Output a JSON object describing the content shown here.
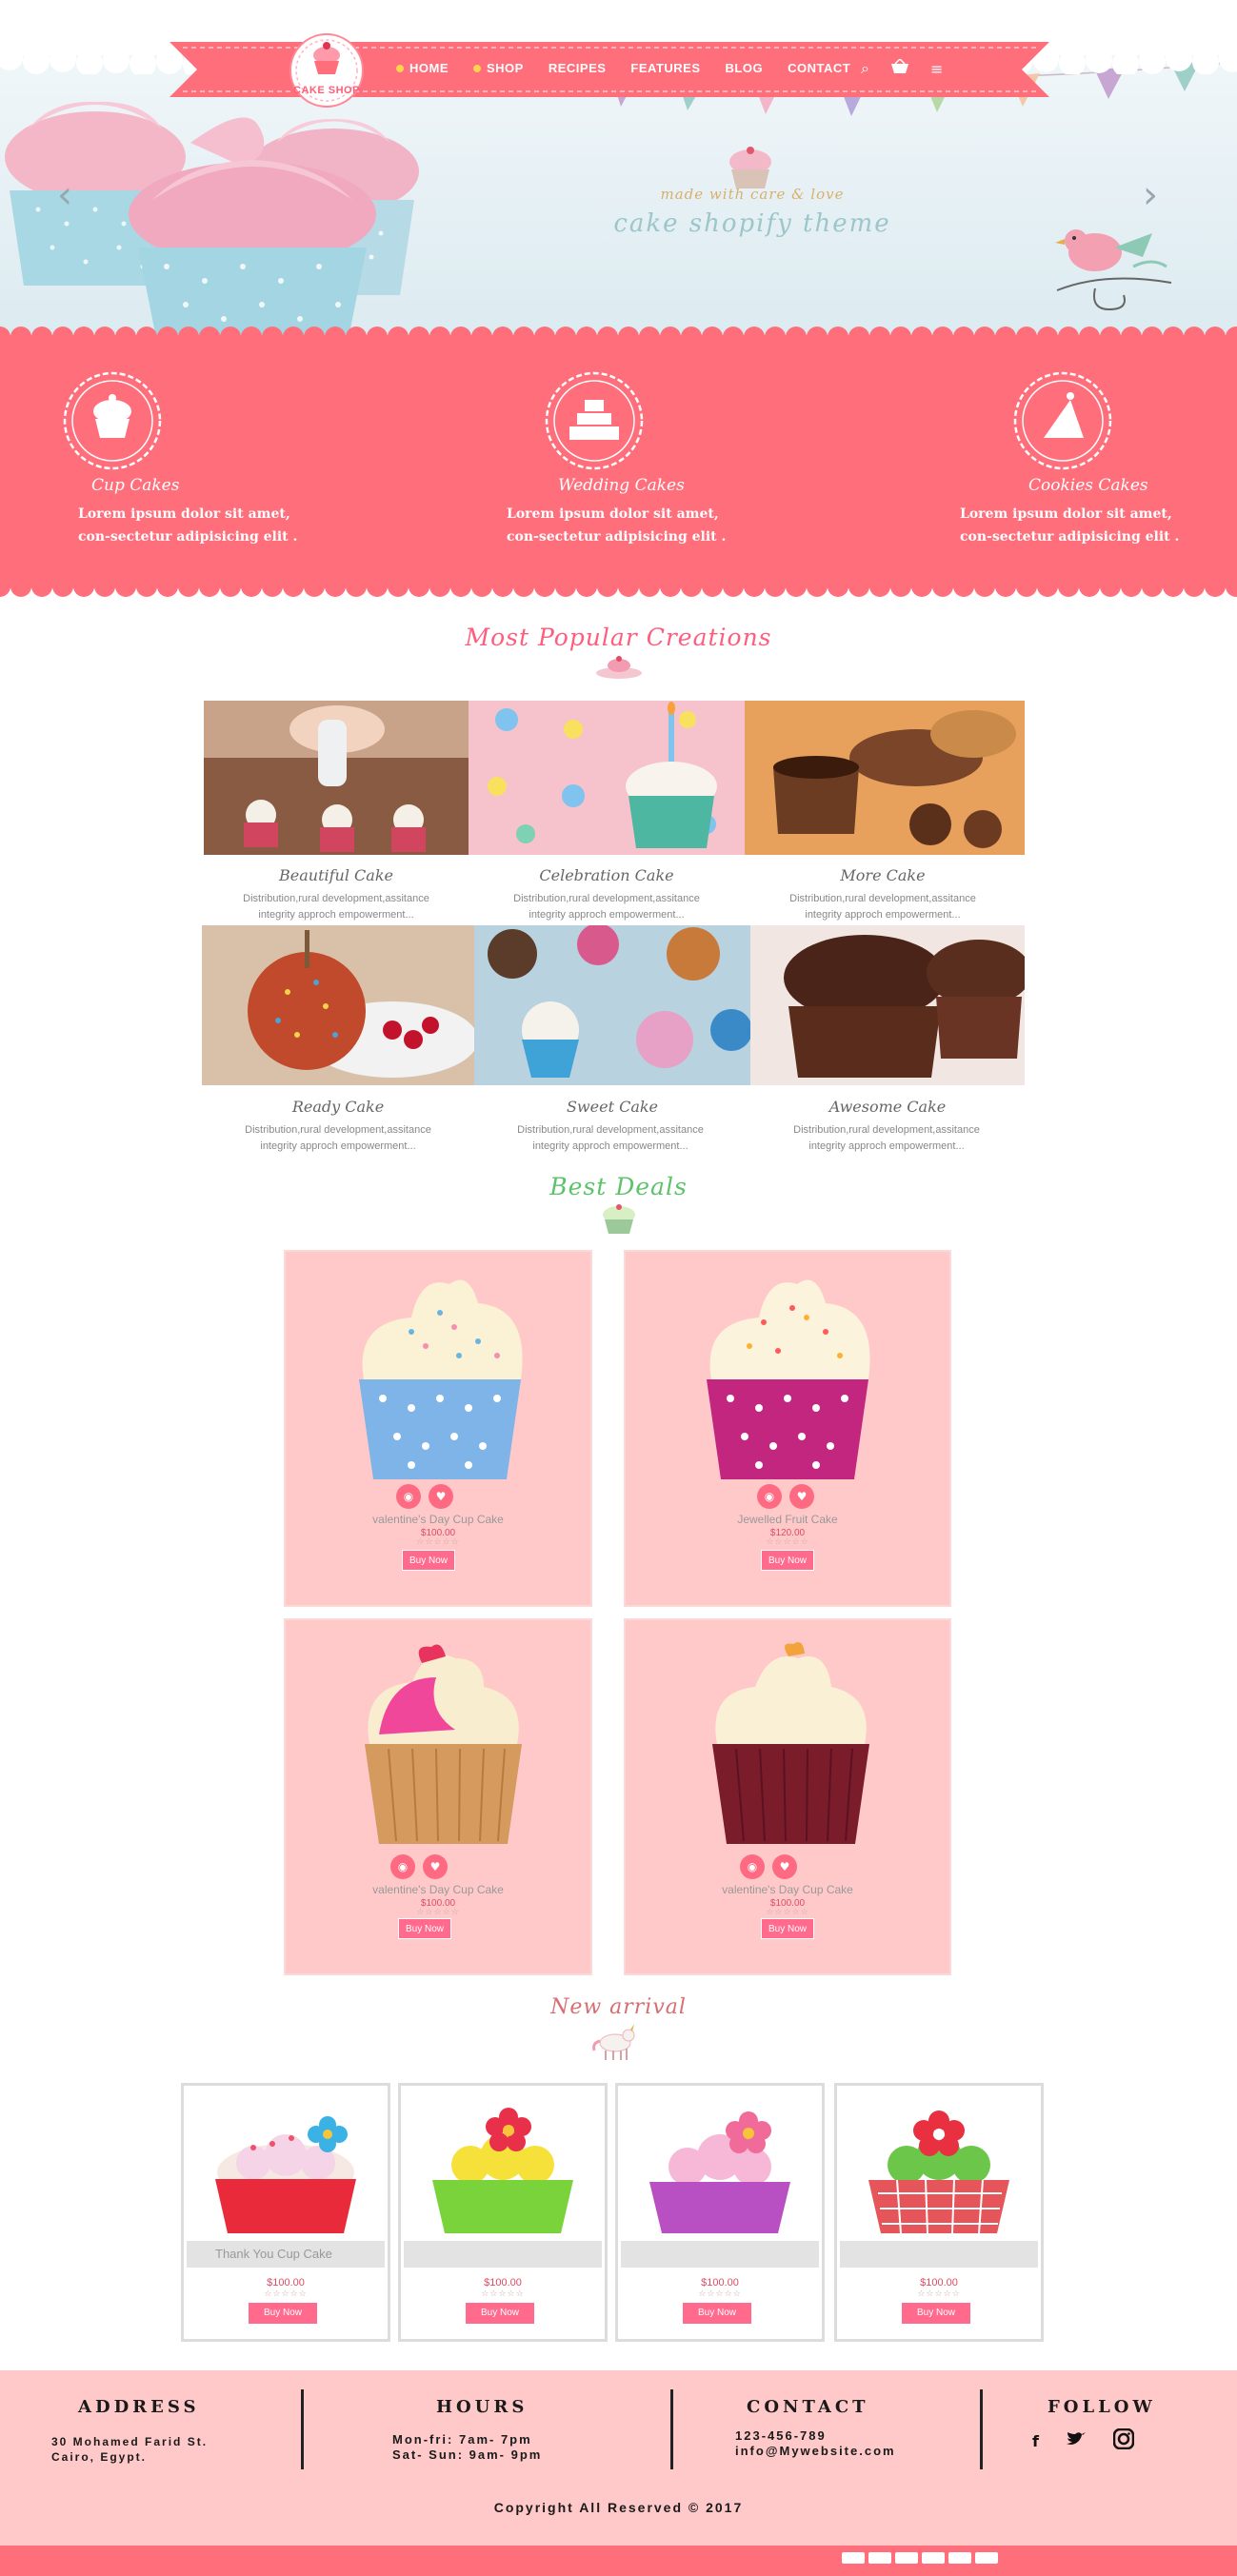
{
  "brand": {
    "logo_text": "CAKE SHOP"
  },
  "nav": {
    "items": [
      {
        "label": "HOME"
      },
      {
        "label": "SHOP"
      },
      {
        "label": "RECIPES"
      },
      {
        "label": "FEATURES"
      },
      {
        "label": "BLOG"
      },
      {
        "label": "CONTACT"
      }
    ],
    "icons": [
      "search-icon",
      "basket-icon",
      "menu-icon"
    ]
  },
  "hero": {
    "tagline": "made with care & love",
    "theme_name": "cake shopify theme",
    "prev_arrow": "‹",
    "next_arrow": "›"
  },
  "features": [
    {
      "title": "Cup Cakes",
      "text": "Lorem ipsum dolor sit amet, con-sectetur adipisicing elit .",
      "icon": "cupcake-icon"
    },
    {
      "title": "Wedding Cakes",
      "text": "Lorem ipsum dolor sit amet, con-sectetur adipisicing elit .",
      "icon": "wedding-cake-icon"
    },
    {
      "title": "Cookies Cakes",
      "text": "Lorem ipsum dolor sit amet, con-sectetur adipisicing elit .",
      "icon": "cake-slice-icon"
    }
  ],
  "popular": {
    "title": "Most Popular Creations",
    "items": [
      {
        "name": "Beautiful Cake",
        "desc": "Distribution,rural development,assitance integrity approch empowerment..."
      },
      {
        "name": "Celebration Cake",
        "desc": "Distribution,rural development,assitance integrity approch empowerment..."
      },
      {
        "name": "More Cake",
        "desc": "Distribution,rural development,assitance integrity approch empowerment..."
      },
      {
        "name": "Ready Cake",
        "desc": "Distribution,rural development,assitance integrity approch empowerment..."
      },
      {
        "name": "Sweet Cake",
        "desc": "Distribution,rural development,assitance integrity approch empowerment..."
      },
      {
        "name": "Awesome Cake",
        "desc": "Distribution,rural development,assitance integrity approch empowerment..."
      }
    ]
  },
  "deals": {
    "title": "Best Deals",
    "buy_label": "Buy Now",
    "stars": "☆☆☆☆☆",
    "items": [
      {
        "name": "valentine's Day Cup Cake",
        "price": "$100.00"
      },
      {
        "name": "Jewelled Fruit Cake",
        "price": "$120.00"
      },
      {
        "name": "valentine's Day Cup Cake",
        "price": "$100.00"
      },
      {
        "name": "valentine's Day Cup Cake",
        "price": "$100.00"
      }
    ]
  },
  "arrivals": {
    "title": "New arrival",
    "buy_label": "Buy Now",
    "stars": "☆☆☆☆☆",
    "items": [
      {
        "name": "Thank You Cup Cake",
        "price": "$100.00"
      },
      {
        "name": "",
        "price": "$100.00"
      },
      {
        "name": "",
        "price": "$100.00"
      },
      {
        "name": "",
        "price": "$100.00"
      }
    ]
  },
  "footer": {
    "address": {
      "heading": "ADDRESS",
      "lines": [
        "30 Mohamed Farid St.",
        "Cairo, Egypt."
      ]
    },
    "hours": {
      "heading": "HOURS",
      "lines": [
        "Mon-fri: 7am- 7pm",
        "Sat- Sun: 9am- 9pm"
      ]
    },
    "contact": {
      "heading": "CONTACT",
      "lines": [
        "123-456-789",
        "info@Mywebsite.com"
      ]
    },
    "follow": {
      "heading": "FOLLOW",
      "icons": [
        "facebook-icon",
        "twitter-icon",
        "instagram-icon"
      ]
    },
    "copyright": "Copyright All Reserved © 2017"
  },
  "colors": {
    "primary": "#ff6e7b",
    "section_pink": "#ff5d7d",
    "section_green": "#5cc36a",
    "section_rose": "#d86d72",
    "card_bg": "#ffc9c9",
    "button": "#ff6a8d"
  }
}
